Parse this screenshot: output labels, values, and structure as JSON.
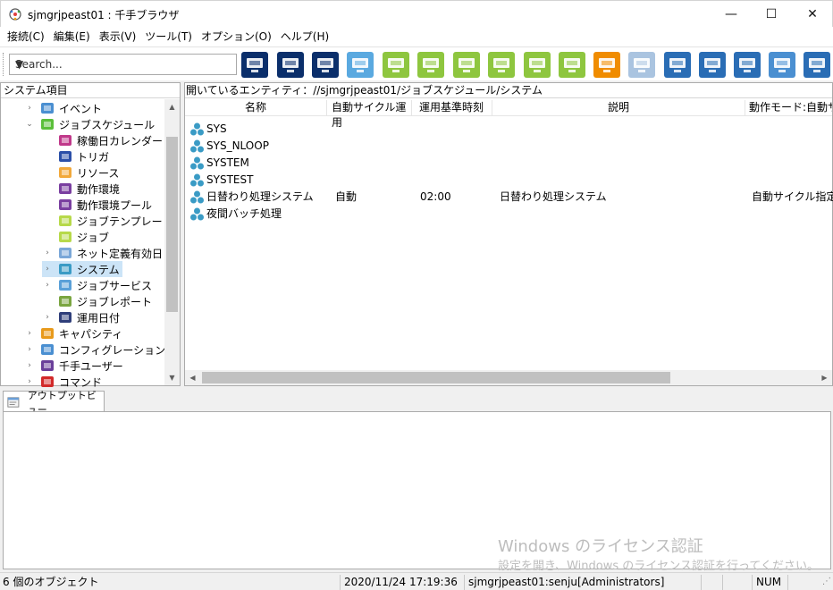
{
  "window": {
    "title": "sjmgrjpeast01 : 千手ブラウザ",
    "controls": {
      "minimize": "—",
      "maximize": "☐",
      "close": "✕"
    }
  },
  "menu": [
    "接続(C)",
    "編集(E)",
    "表示(V)",
    "ツール(T)",
    "オプション(O)",
    "ヘルプ(H)"
  ],
  "toolbar": {
    "search_placeholder": "Search...",
    "buttons": [
      {
        "name": "network-view-icon",
        "color": "#0b2f6b"
      },
      {
        "name": "monitor-view-icon",
        "color": "#0b2f6b"
      },
      {
        "name": "display-layout-icon",
        "color": "#0b2f6b"
      },
      {
        "name": "message-icon",
        "color": "#5aa9e0"
      },
      {
        "name": "gear-check-icon",
        "color": "#8ec63f"
      },
      {
        "name": "check-star-icon",
        "color": "#8ec63f"
      },
      {
        "name": "refresh-star-icon",
        "color": "#8ec63f"
      },
      {
        "name": "checked-monitor-icon",
        "color": "#8ec63f"
      },
      {
        "name": "bar-report-icon",
        "color": "#8ec63f"
      },
      {
        "name": "gantt-icon",
        "color": "#8ec63f"
      },
      {
        "name": "orange-chart-icon",
        "color": "#f08c00"
      },
      {
        "name": "mosaic-icon",
        "color": "#aac4e0"
      },
      {
        "name": "blue-settings-icon",
        "color": "#2a6db5"
      },
      {
        "name": "blue-check-icon",
        "color": "#2a6db5"
      },
      {
        "name": "blue-export-icon",
        "color": "#2a6db5"
      },
      {
        "name": "log-icon",
        "color": "#4a8fd1"
      },
      {
        "name": "radar-icon",
        "color": "#2a6db5"
      }
    ]
  },
  "left_panel": {
    "header": "システム項目",
    "items": [
      {
        "label": "イベント",
        "icon": "event-icon",
        "arrow": "›",
        "indent": 1
      },
      {
        "label": "ジョブスケジュール",
        "icon": "schedule-icon",
        "arrow": "⌄",
        "indent": 1
      },
      {
        "label": "稼働日カレンダー",
        "icon": "calendar-icon",
        "arrow": "",
        "indent": 2
      },
      {
        "label": "トリガ",
        "icon": "trigger-icon",
        "arrow": "",
        "indent": 2
      },
      {
        "label": "リソース",
        "icon": "resource-icon",
        "arrow": "",
        "indent": 2
      },
      {
        "label": "動作環境",
        "icon": "environment-icon",
        "arrow": "",
        "indent": 2
      },
      {
        "label": "動作環境プール",
        "icon": "environment-pool-icon",
        "arrow": "",
        "indent": 2
      },
      {
        "label": "ジョブテンプレート",
        "icon": "job-template-icon",
        "arrow": "",
        "indent": 2
      },
      {
        "label": "ジョブ",
        "icon": "job-icon",
        "arrow": "",
        "indent": 2
      },
      {
        "label": "ネット定義有効日",
        "icon": "net-definition-icon",
        "arrow": "›",
        "indent": 2
      },
      {
        "label": "システム",
        "icon": "system-icon",
        "arrow": "›",
        "indent": 2,
        "selected": true
      },
      {
        "label": "ジョブサービス",
        "icon": "job-service-icon",
        "arrow": "›",
        "indent": 2
      },
      {
        "label": "ジョブレポート",
        "icon": "job-report-icon",
        "arrow": "",
        "indent": 2
      },
      {
        "label": "運用日付",
        "icon": "operation-date-icon",
        "arrow": "›",
        "indent": 2
      },
      {
        "label": "キャパシティ",
        "icon": "capacity-icon",
        "arrow": "›",
        "indent": 1
      },
      {
        "label": "コンフィグレーション",
        "icon": "configuration-icon",
        "arrow": "›",
        "indent": 1
      },
      {
        "label": "千手ユーザー",
        "icon": "user-icon",
        "arrow": "›",
        "indent": 1
      },
      {
        "label": "コマンド",
        "icon": "command-icon",
        "arrow": "›",
        "indent": 1
      }
    ]
  },
  "right_panel": {
    "path": "開いているエンティティ：//sjmgrjpeast01/ジョブスケジュール/システム",
    "columns": [
      "名称",
      "自動サイクル運用",
      "運用基準時刻",
      "説明",
      "動作モード:自動サイ"
    ],
    "rows": [
      {
        "name": "SYS",
        "auto": "",
        "time": "",
        "desc": "",
        "mode": ""
      },
      {
        "name": "SYS_NLOOP",
        "auto": "",
        "time": "",
        "desc": "",
        "mode": ""
      },
      {
        "name": "SYSTEM",
        "auto": "",
        "time": "",
        "desc": "",
        "mode": ""
      },
      {
        "name": "SYSTEST",
        "auto": "",
        "time": "",
        "desc": "",
        "mode": ""
      },
      {
        "name": "日替わり処理システム",
        "auto": "自動",
        "time": "02:00",
        "desc": "日替わり処理システム",
        "mode": "自動サイクル指定"
      },
      {
        "name": "夜間バッチ処理",
        "auto": "",
        "time": "",
        "desc": "",
        "mode": ""
      }
    ]
  },
  "output": {
    "tab_label": "アウトプットビュー"
  },
  "watermark": {
    "line1": "Windows のライセンス認証",
    "line2": "設定を開き、Windows のライセンス認証を行ってください。"
  },
  "status": {
    "count": "6 個のオブジェクト",
    "datetime": "2020/11/24 17:19:36",
    "user": "sjmgrjpeast01:senju[Administrators]",
    "num": "NUM"
  }
}
